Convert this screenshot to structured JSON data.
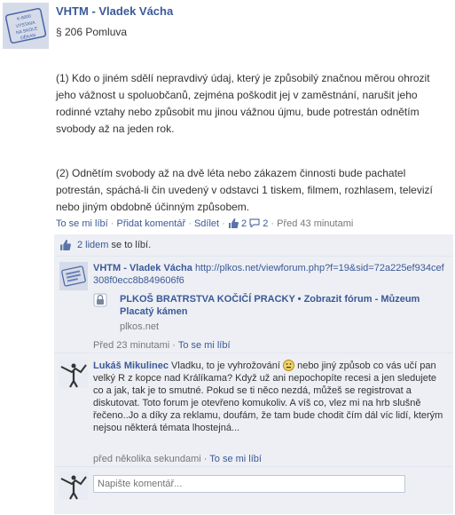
{
  "post": {
    "author": "VHTM - Vladek Vácha",
    "heading": "§ 206 Pomluva",
    "paragraph1": "(1) Kdo o jiném sdělí nepravdivý údaj, který je způsobilý značnou měrou ohrozit jeho vážnost u spoluobčanů, zejména poškodit jej v zaměstnání, narušit jeho rodinné vztahy nebo způsobit mu jinou vážnou újmu, bude potrestán odnětím svobody až na jeden rok.",
    "paragraph2": "(2) Odnětím svobody až na dvě léta nebo zákazem činnosti bude pachatel potrestán, spáchá-li čin uvedený v odstavci 1 tiskem, filmem, rozhlasem, televizí nebo jiným obdobně účinným způsobem.",
    "actions": {
      "like": "To se mi líbí",
      "comment": "Přidat komentář",
      "share": "Sdílet",
      "like_count": "2",
      "comment_count": "2",
      "time": "Před 43 minutami"
    },
    "avatar_stamp_text": [
      "K-6000",
      "VÝSTAVA",
      "NA SKOLE",
      "DĚKAN"
    ]
  },
  "likes": {
    "count_link": "2 lidem",
    "suffix": " se to líbí."
  },
  "share_item": {
    "author": "VHTM - Vladek Vácha",
    "url": "http://plkos.net/viewforum.php?f=19&sid=72a225ef934cef308f0ecc8b849606f6",
    "attachment_title": "PLKOŠ BRATRSTVA KOČIČÍ PRACKY • Zobrazit fórum - Můzeum Placatý kámen",
    "attachment_domain": "plkos.net",
    "time": "Před 23 minutami",
    "like": "To se mi líbí"
  },
  "comment": {
    "author": "Lukáš Mikulinec",
    "text_part1": "Vladku, to je vyhrožování",
    "text_part2": "nebo jiný způsob co vás učí pan velký R z kopce nad Králíkama? Když už ani nepochopíte recesi a jen sledujete co a jak, tak je to smutné. Pokud se ti něco nezdá, můžeš se registrovat a diskutovat. Toto forum je otevřeno komukoliv. A víš co, vlez mi na hrb slušně řečeno..Jo a díky za reklamu, doufám, že tam bude chodit čím dál víc lidí, kterým nejsou některá témata lhostejná...",
    "time": "před několika sekundami",
    "like": "To se mi líbí"
  },
  "composer": {
    "placeholder": "Napište komentář..."
  },
  "colors": {
    "link": "#3b5998",
    "ufi_bg": "#edeff4"
  }
}
